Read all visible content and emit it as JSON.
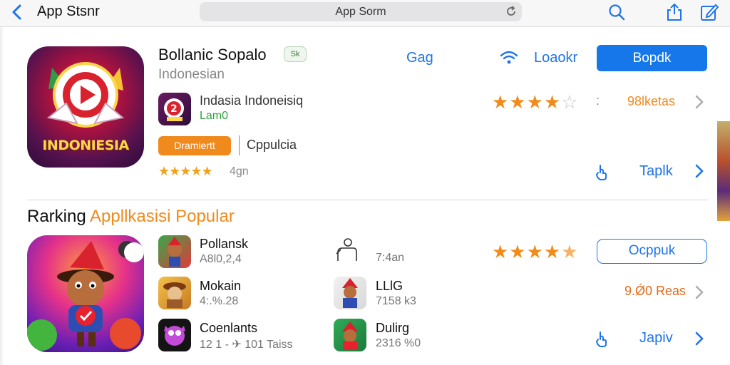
{
  "topbar": {
    "title": "App Stsnr",
    "search_text": "App Sorm"
  },
  "app": {
    "name": "Bollanic Sopalo",
    "badge": "Sk",
    "subtitle": "Indonesian",
    "icon_label": "INDONIESIA",
    "developer_name": "Indasia Indoneisiq",
    "developer_tag": "Lam0",
    "orange_button": "Dramiertt",
    "category": "Cppulcia",
    "rating_count": "4gn",
    "link_gag": "Gag",
    "link_loader": "Loaokr",
    "primary_button": "Bopdk",
    "stars_display": "★★★★★",
    "reviews": "98lketas",
    "tap_label": "Taplk",
    "rating_stars": 4
  },
  "ranking": {
    "title_part1": "Rarking",
    "title_part2": "Appllkasisi Popular",
    "items": [
      {
        "name": "Pollansk",
        "meta": "A8l0,2,4"
      },
      {
        "name": "Mokain",
        "meta": "4:.%.28"
      },
      {
        "name": "Coenlants",
        "meta": "12 1 - ✈ 101 Taiss"
      },
      {
        "name": "",
        "meta": "7:4an"
      },
      {
        "name": "LLlG",
        "meta": "7158 k3"
      },
      {
        "name": "Dulirg",
        "meta": "2316 %0"
      }
    ],
    "rating_stars": 4.5,
    "outline_button": "Ocppuk",
    "reviews": "9.Ǿ0 Reas",
    "tap_label": "Japiv"
  },
  "colors": {
    "accent": "#1677ea",
    "orange": "#f08a1c",
    "green": "#2fa43d"
  }
}
